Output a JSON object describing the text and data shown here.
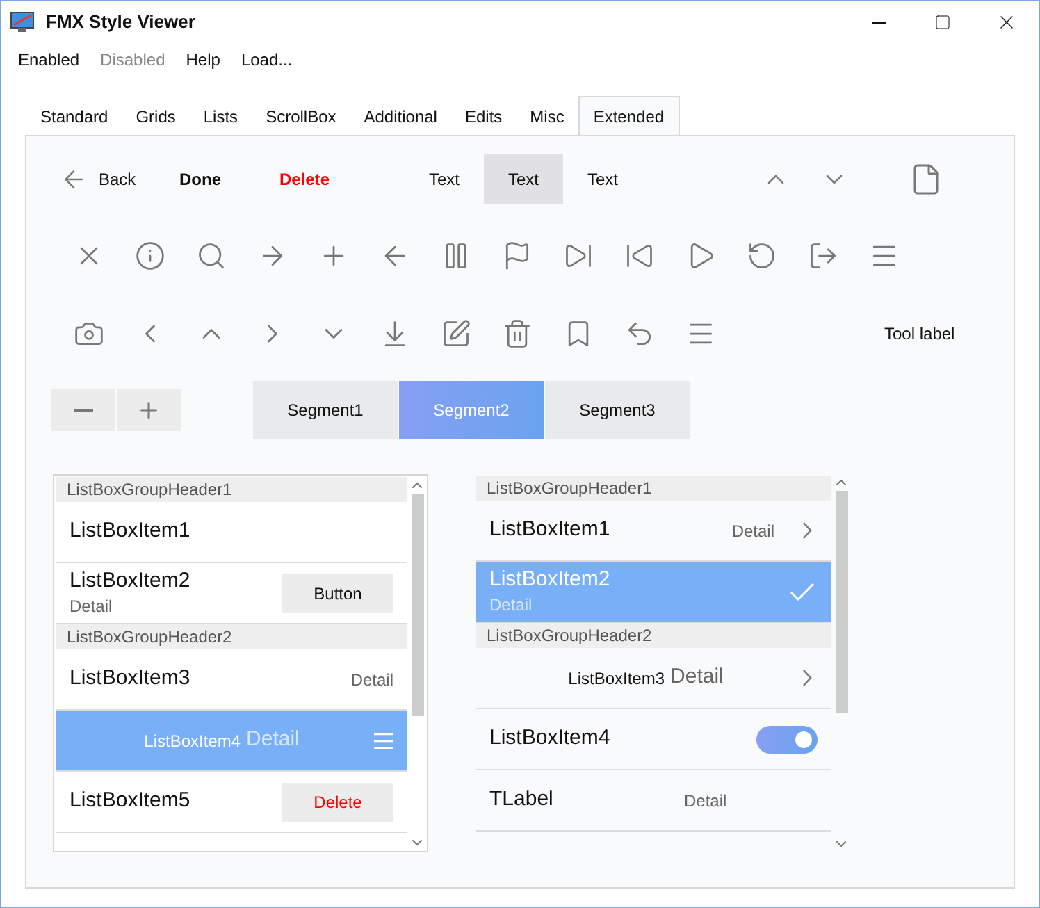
{
  "window": {
    "title": "FMX Style Viewer"
  },
  "menu": [
    {
      "label": "Enabled",
      "disabled": false
    },
    {
      "label": "Disabled",
      "disabled": true
    },
    {
      "label": "Help",
      "disabled": false
    },
    {
      "label": "Load...",
      "disabled": false
    }
  ],
  "tabs": [
    {
      "label": "Standard",
      "selected": false
    },
    {
      "label": "Grids",
      "selected": false
    },
    {
      "label": "Lists",
      "selected": false
    },
    {
      "label": "ScrollBox",
      "selected": false
    },
    {
      "label": "Additional",
      "selected": false
    },
    {
      "label": "Edits",
      "selected": false
    },
    {
      "label": "Misc",
      "selected": false
    },
    {
      "label": "Extended",
      "selected": true
    }
  ],
  "toolbar": {
    "back": "Back",
    "done": "Done",
    "delete": "Delete",
    "text_segments": [
      {
        "label": "Text",
        "selected": false
      },
      {
        "label": "Text",
        "selected": true
      },
      {
        "label": "Text",
        "selected": false
      }
    ],
    "tool_label": "Tool label"
  },
  "segments": [
    {
      "label": "Segment1",
      "selected": false
    },
    {
      "label": "Segment2",
      "selected": true
    },
    {
      "label": "Segment3",
      "selected": false
    }
  ],
  "list_left": [
    {
      "kind": "header",
      "text": "ListBoxGroupHeader1"
    },
    {
      "kind": "plain",
      "text": "ListBoxItem1",
      "selected": false
    },
    {
      "kind": "subtitle",
      "text": "ListBoxItem2",
      "detail": "Detail",
      "button": "Button",
      "destructive": false,
      "selected": false
    },
    {
      "kind": "header",
      "text": "ListBoxGroupHeader2"
    },
    {
      "kind": "right_detail",
      "text": "ListBoxItem3",
      "detail": "Detail",
      "selected": false
    },
    {
      "kind": "inline_detail",
      "text": "ListBoxItem4",
      "detail": "Detail",
      "menu_icon": true,
      "selected": true
    },
    {
      "kind": "plain",
      "text": "ListBoxItem5",
      "button": "Delete",
      "destructive": true,
      "selected": false
    }
  ],
  "list_right": [
    {
      "kind": "header",
      "text": "ListBoxGroupHeader1"
    },
    {
      "kind": "right_detail",
      "text": "ListBoxItem1",
      "detail": "Detail",
      "chevron": true,
      "selected": false
    },
    {
      "kind": "subtitle",
      "text": "ListBoxItem2",
      "detail": "Detail",
      "checkmark": true,
      "selected": true
    },
    {
      "kind": "header",
      "text": "ListBoxGroupHeader2"
    },
    {
      "kind": "inline_detail",
      "text": "ListBoxItem3",
      "detail": "Detail",
      "chevron": true,
      "selected": false
    },
    {
      "kind": "switch",
      "text": "ListBoxItem4",
      "on": true,
      "selected": false
    },
    {
      "kind": "label",
      "text": "TLabel",
      "detail": "Detail",
      "selected": false
    }
  ]
}
